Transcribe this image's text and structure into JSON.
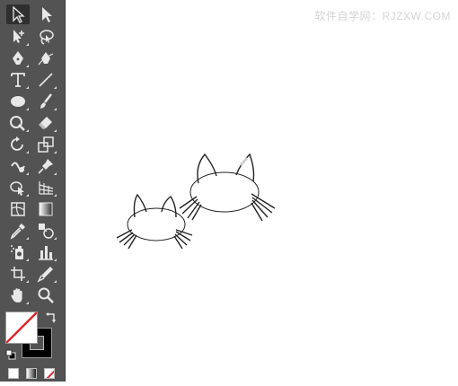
{
  "watermark": {
    "text": "软件自学网：RJZXW.COM"
  },
  "tools": {
    "selection": "selection-tool",
    "direct_selection": "direct-selection-tool",
    "active_tool": "selection-tool"
  },
  "colors": {
    "toolbar_bg": "#535353",
    "canvas_bg": "#ffffff",
    "fill": "none",
    "stroke": "#000000",
    "none_slash": "#e0262b"
  },
  "canvas": {
    "objects": [
      {
        "type": "cat-face",
        "ears": 2,
        "whisker_groups": 4
      },
      {
        "type": "cat-face",
        "ears": 2,
        "whisker_groups": 4
      }
    ]
  }
}
